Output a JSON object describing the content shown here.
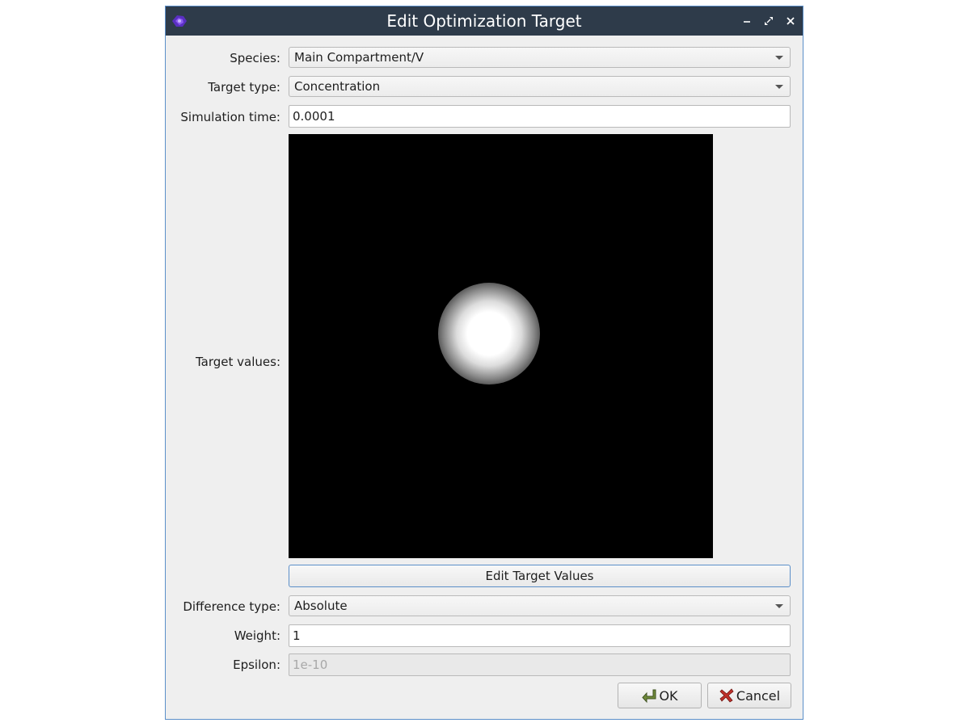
{
  "window": {
    "title": "Edit Optimization Target",
    "icon": "app-logo-icon",
    "controls": [
      "minimize-icon",
      "restore-icon",
      "close-icon"
    ]
  },
  "form": {
    "species": {
      "label": "Species:",
      "value": "Main Compartment/V"
    },
    "target_type": {
      "label": "Target type:",
      "value": "Concentration"
    },
    "simulation_time": {
      "label": "Simulation time:",
      "value": "0.0001"
    },
    "target_values": {
      "label": "Target values:",
      "edit_button": "Edit Target Values"
    },
    "difference_type": {
      "label": "Difference type:",
      "value": "Absolute"
    },
    "weight": {
      "label": "Weight:",
      "value": "1"
    },
    "epsilon": {
      "label": "Epsilon:",
      "placeholder": "1e-10",
      "enabled": false
    }
  },
  "buttons": {
    "ok": "OK",
    "cancel": "Cancel"
  },
  "colors": {
    "titlebar": "#2e3b4a",
    "window_bg": "#efefef",
    "accent_border": "#5b8fc9",
    "image_bg": "#000000"
  }
}
